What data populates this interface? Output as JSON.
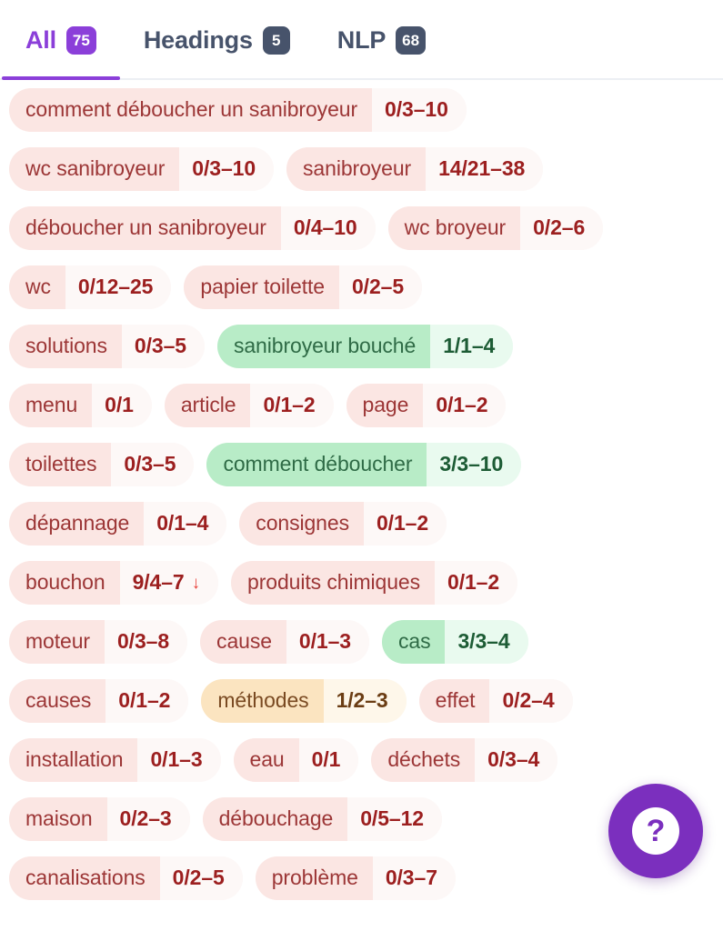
{
  "tabs": [
    {
      "label": "All",
      "count": "75",
      "active": true
    },
    {
      "label": "Headings",
      "count": "5",
      "active": false
    },
    {
      "label": "NLP",
      "count": "68",
      "active": false
    }
  ],
  "colors": {
    "accent_purple": "#8b3fd9",
    "fab_purple": "#7b2fbe",
    "inactive_slate": "#47536b",
    "pill_red_bg": "#fbe6e3",
    "pill_red_text": "#9c3636",
    "pill_green_bg": "#b8ecc7",
    "pill_green_text": "#2f6b46",
    "pill_orange_bg": "#fbe4c0",
    "pill_orange_text": "#7a4a22",
    "arrow_red": "#e8413a"
  },
  "rows": [
    [
      {
        "term": "comment déboucher un sanibroyeur",
        "count": "0/3–10",
        "tone": "red",
        "arrow": ""
      }
    ],
    [
      {
        "term": "wc sanibroyeur",
        "count": "0/3–10",
        "tone": "red",
        "arrow": ""
      },
      {
        "term": "sanibroyeur",
        "count": "14/21–38",
        "tone": "red",
        "arrow": ""
      }
    ],
    [
      {
        "term": "déboucher un sanibroyeur",
        "count": "0/4–10",
        "tone": "red",
        "arrow": ""
      },
      {
        "term": "wc broyeur",
        "count": "0/2–6",
        "tone": "red",
        "arrow": ""
      }
    ],
    [
      {
        "term": "wc",
        "count": "0/12–25",
        "tone": "red",
        "arrow": ""
      },
      {
        "term": "papier toilette",
        "count": "0/2–5",
        "tone": "red",
        "arrow": ""
      }
    ],
    [
      {
        "term": "solutions",
        "count": "0/3–5",
        "tone": "red",
        "arrow": ""
      },
      {
        "term": "sanibroyeur bouché",
        "count": "1/1–4",
        "tone": "green",
        "arrow": ""
      }
    ],
    [
      {
        "term": "menu",
        "count": "0/1",
        "tone": "red",
        "arrow": ""
      },
      {
        "term": "article",
        "count": "0/1–2",
        "tone": "red",
        "arrow": ""
      },
      {
        "term": "page",
        "count": "0/1–2",
        "tone": "red",
        "arrow": ""
      }
    ],
    [
      {
        "term": "toilettes",
        "count": "0/3–5",
        "tone": "red",
        "arrow": ""
      },
      {
        "term": "comment déboucher",
        "count": "3/3–10",
        "tone": "green",
        "arrow": ""
      }
    ],
    [
      {
        "term": "dépannage",
        "count": "0/1–4",
        "tone": "red",
        "arrow": ""
      },
      {
        "term": "consignes",
        "count": "0/1–2",
        "tone": "red",
        "arrow": ""
      }
    ],
    [
      {
        "term": "bouchon",
        "count": "9/4–7",
        "tone": "red",
        "arrow": "↓"
      },
      {
        "term": "produits chimiques",
        "count": "0/1–2",
        "tone": "red",
        "arrow": ""
      }
    ],
    [
      {
        "term": "moteur",
        "count": "0/3–8",
        "tone": "red",
        "arrow": ""
      },
      {
        "term": "cause",
        "count": "0/1–3",
        "tone": "red",
        "arrow": ""
      },
      {
        "term": "cas",
        "count": "3/3–4",
        "tone": "green",
        "arrow": ""
      }
    ],
    [
      {
        "term": "causes",
        "count": "0/1–2",
        "tone": "red",
        "arrow": ""
      },
      {
        "term": "méthodes",
        "count": "1/2–3",
        "tone": "orange",
        "arrow": ""
      },
      {
        "term": "effet",
        "count": "0/2–4",
        "tone": "red",
        "arrow": ""
      }
    ],
    [
      {
        "term": "installation",
        "count": "0/1–3",
        "tone": "red",
        "arrow": ""
      },
      {
        "term": "eau",
        "count": "0/1",
        "tone": "red",
        "arrow": ""
      },
      {
        "term": "déchets",
        "count": "0/3–4",
        "tone": "red",
        "arrow": ""
      }
    ],
    [
      {
        "term": "maison",
        "count": "0/2–3",
        "tone": "red",
        "arrow": ""
      },
      {
        "term": "débouchage",
        "count": "0/5–12",
        "tone": "red",
        "arrow": ""
      }
    ],
    [
      {
        "term": "canalisations",
        "count": "0/2–5",
        "tone": "red",
        "arrow": ""
      },
      {
        "term": "problème",
        "count": "0/3–7",
        "tone": "red",
        "arrow": ""
      }
    ]
  ],
  "help_button": {
    "glyph": "?",
    "icon": "question-mark-icon"
  }
}
